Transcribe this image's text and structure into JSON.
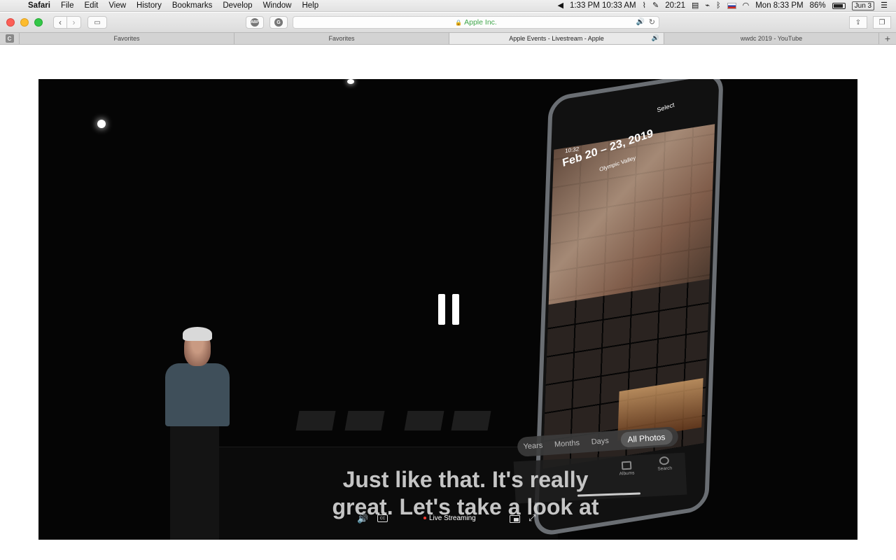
{
  "menubar": {
    "apple_icon": "apple-logo-icon",
    "app_name": "Safari",
    "items": [
      "File",
      "Edit",
      "View",
      "History",
      "Bookmarks",
      "Develop",
      "Window",
      "Help"
    ],
    "status": {
      "world_clock": "1:33 PM 10:33 AM",
      "timer": "20:21",
      "clock": "Mon 8:33 PM",
      "battery": "86%",
      "calendar_badge": "Jun 3"
    }
  },
  "toolbar": {
    "abp_label": "ABP",
    "grammarly_label": "G",
    "url": "Apple Inc.",
    "url_color": "#3fa64a"
  },
  "tabs": {
    "pinned_label": "C",
    "items": [
      {
        "title": "Favorites",
        "active": false
      },
      {
        "title": "Favorites",
        "active": false
      },
      {
        "title": "Apple Events - Livestream - Apple",
        "active": true
      },
      {
        "title": "wwdc 2019 - YouTube",
        "active": false
      }
    ],
    "new_tab_label": "+"
  },
  "video": {
    "captions": [
      "Just like that.  It's really",
      "great.  Let's take a look at"
    ],
    "live_label": "Live Streaming",
    "live_color": "#ff3b30",
    "state": "paused",
    "phone": {
      "time": "10:32",
      "date_range": "Feb 20 – 23, 2019",
      "location": "Olympic Valley",
      "select_label": "Select",
      "segments": [
        "Years",
        "Months",
        "Days",
        "All Photos"
      ],
      "active_segment": "All Photos",
      "tab_labels": [
        "Albums",
        "Search"
      ]
    }
  }
}
